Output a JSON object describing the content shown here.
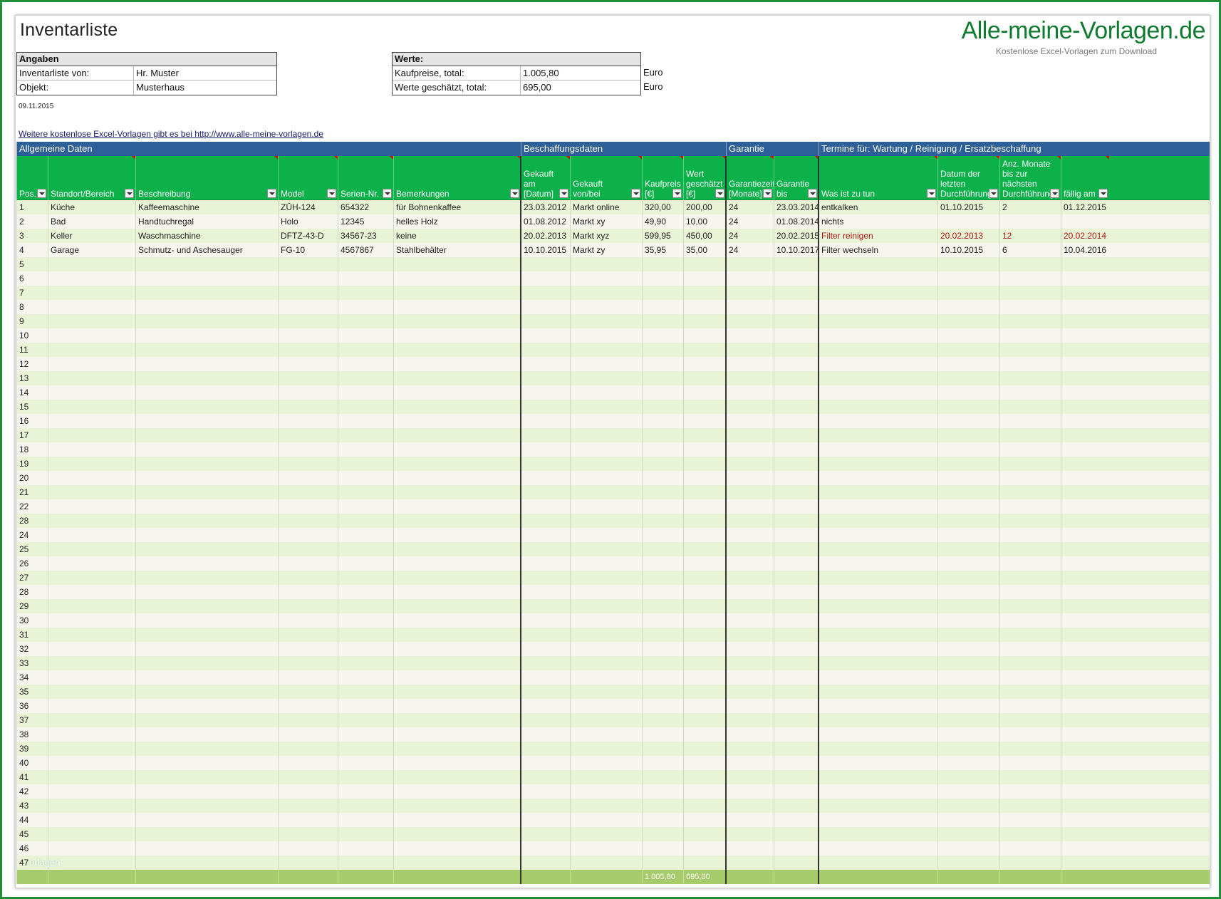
{
  "title": "Inventarliste",
  "logo": {
    "main": "Alle-meine-Vorlagen.de",
    "sub": "Kostenlose Excel-Vorlagen zum Download"
  },
  "angaben": {
    "header": "Angaben",
    "rows": [
      {
        "label": "Inventarliste von:",
        "value": "Hr. Muster"
      },
      {
        "label": "Objekt:",
        "value": "Musterhaus"
      }
    ]
  },
  "werte": {
    "header": "Werte:",
    "rows": [
      {
        "label": "Kaufpreise, total:",
        "value": "1.005,80",
        "unit": "Euro"
      },
      {
        "label": "Werte geschätzt, total:",
        "value": "695,00",
        "unit": "Euro"
      }
    ]
  },
  "date": "09.11.2015",
  "link": "Weitere kostenlose Excel-Vorlagen gibt es bei http://www.alle-meine-vorlagen.de",
  "groups": [
    "Allgemeine Daten",
    "Beschaffungsdaten",
    "Garantie",
    "Termine für: Wartung / Reinigung / Ersatzbeschaffung"
  ],
  "columns": [
    "Pos.",
    "Standort/Bereich",
    "Beschreibung",
    "Model",
    "Serien-Nr.",
    "Bemerkungen",
    "Gekauft am [Datum]",
    "Gekauft von/bei",
    "Kaufpreis [€]",
    "Wert geschätzt [€]",
    "Garantiezeit [Monate]",
    "Garantie bis",
    "Was ist zu tun",
    "Datum der letzten Durchführung",
    "Anz. Monate bis zur nächsten Durchführung",
    "fällig am"
  ],
  "rows": [
    [
      "1",
      "Küche",
      "Kaffeemaschine",
      "ZÜH-124",
      "654322",
      "für Bohnenkaffee",
      "23.03.2012",
      "Markt online",
      "320,00",
      "200,00",
      "24",
      "23.03.2014",
      "entkalken",
      "01.10.2015",
      "2",
      "01.12.2015"
    ],
    [
      "2",
      "Bad",
      "Handtuchregal",
      "Holo",
      "12345",
      "helles Holz",
      "01.08.2012",
      "Markt xy",
      "49,90",
      "10,00",
      "24",
      "01.08.2014",
      "nichts",
      "",
      "",
      ""
    ],
    [
      "3",
      "Keller",
      "Waschmaschine",
      "DFTZ-43-D",
      "34567-23",
      "keine",
      "20.02.2013",
      "Markt xyz",
      "599,95",
      "450,00",
      "24",
      "20.02.2015",
      "Filter reinigen",
      "20.02.2013",
      "12",
      "20.02.2014"
    ],
    [
      "4",
      "Garage",
      "Schmutz- und Aschesauger",
      "FG-10",
      "4567867",
      "Stahlbehälter",
      "10.10.2015",
      "Markt zy",
      "35,95",
      "35,00",
      "24",
      "10.10.2017",
      "Filter wechseln",
      "10.10.2015",
      "6",
      "10.04.2016"
    ],
    [
      "5"
    ],
    [
      "6"
    ],
    [
      "7"
    ],
    [
      "8"
    ],
    [
      "9"
    ],
    [
      "10"
    ],
    [
      "11"
    ],
    [
      "12"
    ],
    [
      "13"
    ],
    [
      "14"
    ],
    [
      "15"
    ],
    [
      "16"
    ],
    [
      "17"
    ],
    [
      "18"
    ],
    [
      "19"
    ],
    [
      "20"
    ],
    [
      "21"
    ],
    [
      "22"
    ],
    [
      "28"
    ],
    [
      "24"
    ],
    [
      "25"
    ],
    [
      "26"
    ],
    [
      "27"
    ],
    [
      "28"
    ],
    [
      "29"
    ],
    [
      "30"
    ],
    [
      "31"
    ],
    [
      "32"
    ],
    [
      "33"
    ],
    [
      "34"
    ],
    [
      "35"
    ],
    [
      "36"
    ],
    [
      "37"
    ],
    [
      "38"
    ],
    [
      "39"
    ],
    [
      "40"
    ],
    [
      "41"
    ],
    [
      "42"
    ],
    [
      "43"
    ],
    [
      "44"
    ],
    [
      "45"
    ],
    [
      "46"
    ],
    [
      "47"
    ]
  ],
  "red_row": 2,
  "overlay_text": "orlagen",
  "totals": {
    "kaufpreis": "1.005,80",
    "wert": "695,00"
  },
  "colors": {
    "group_bg": "#2d5f98",
    "header_bg": "#0cb14a",
    "total_bg": "#a6cb6a",
    "row_odd": "#e9f3d6",
    "row_even": "#f6f6ef",
    "logo": "#0e7a2e"
  }
}
